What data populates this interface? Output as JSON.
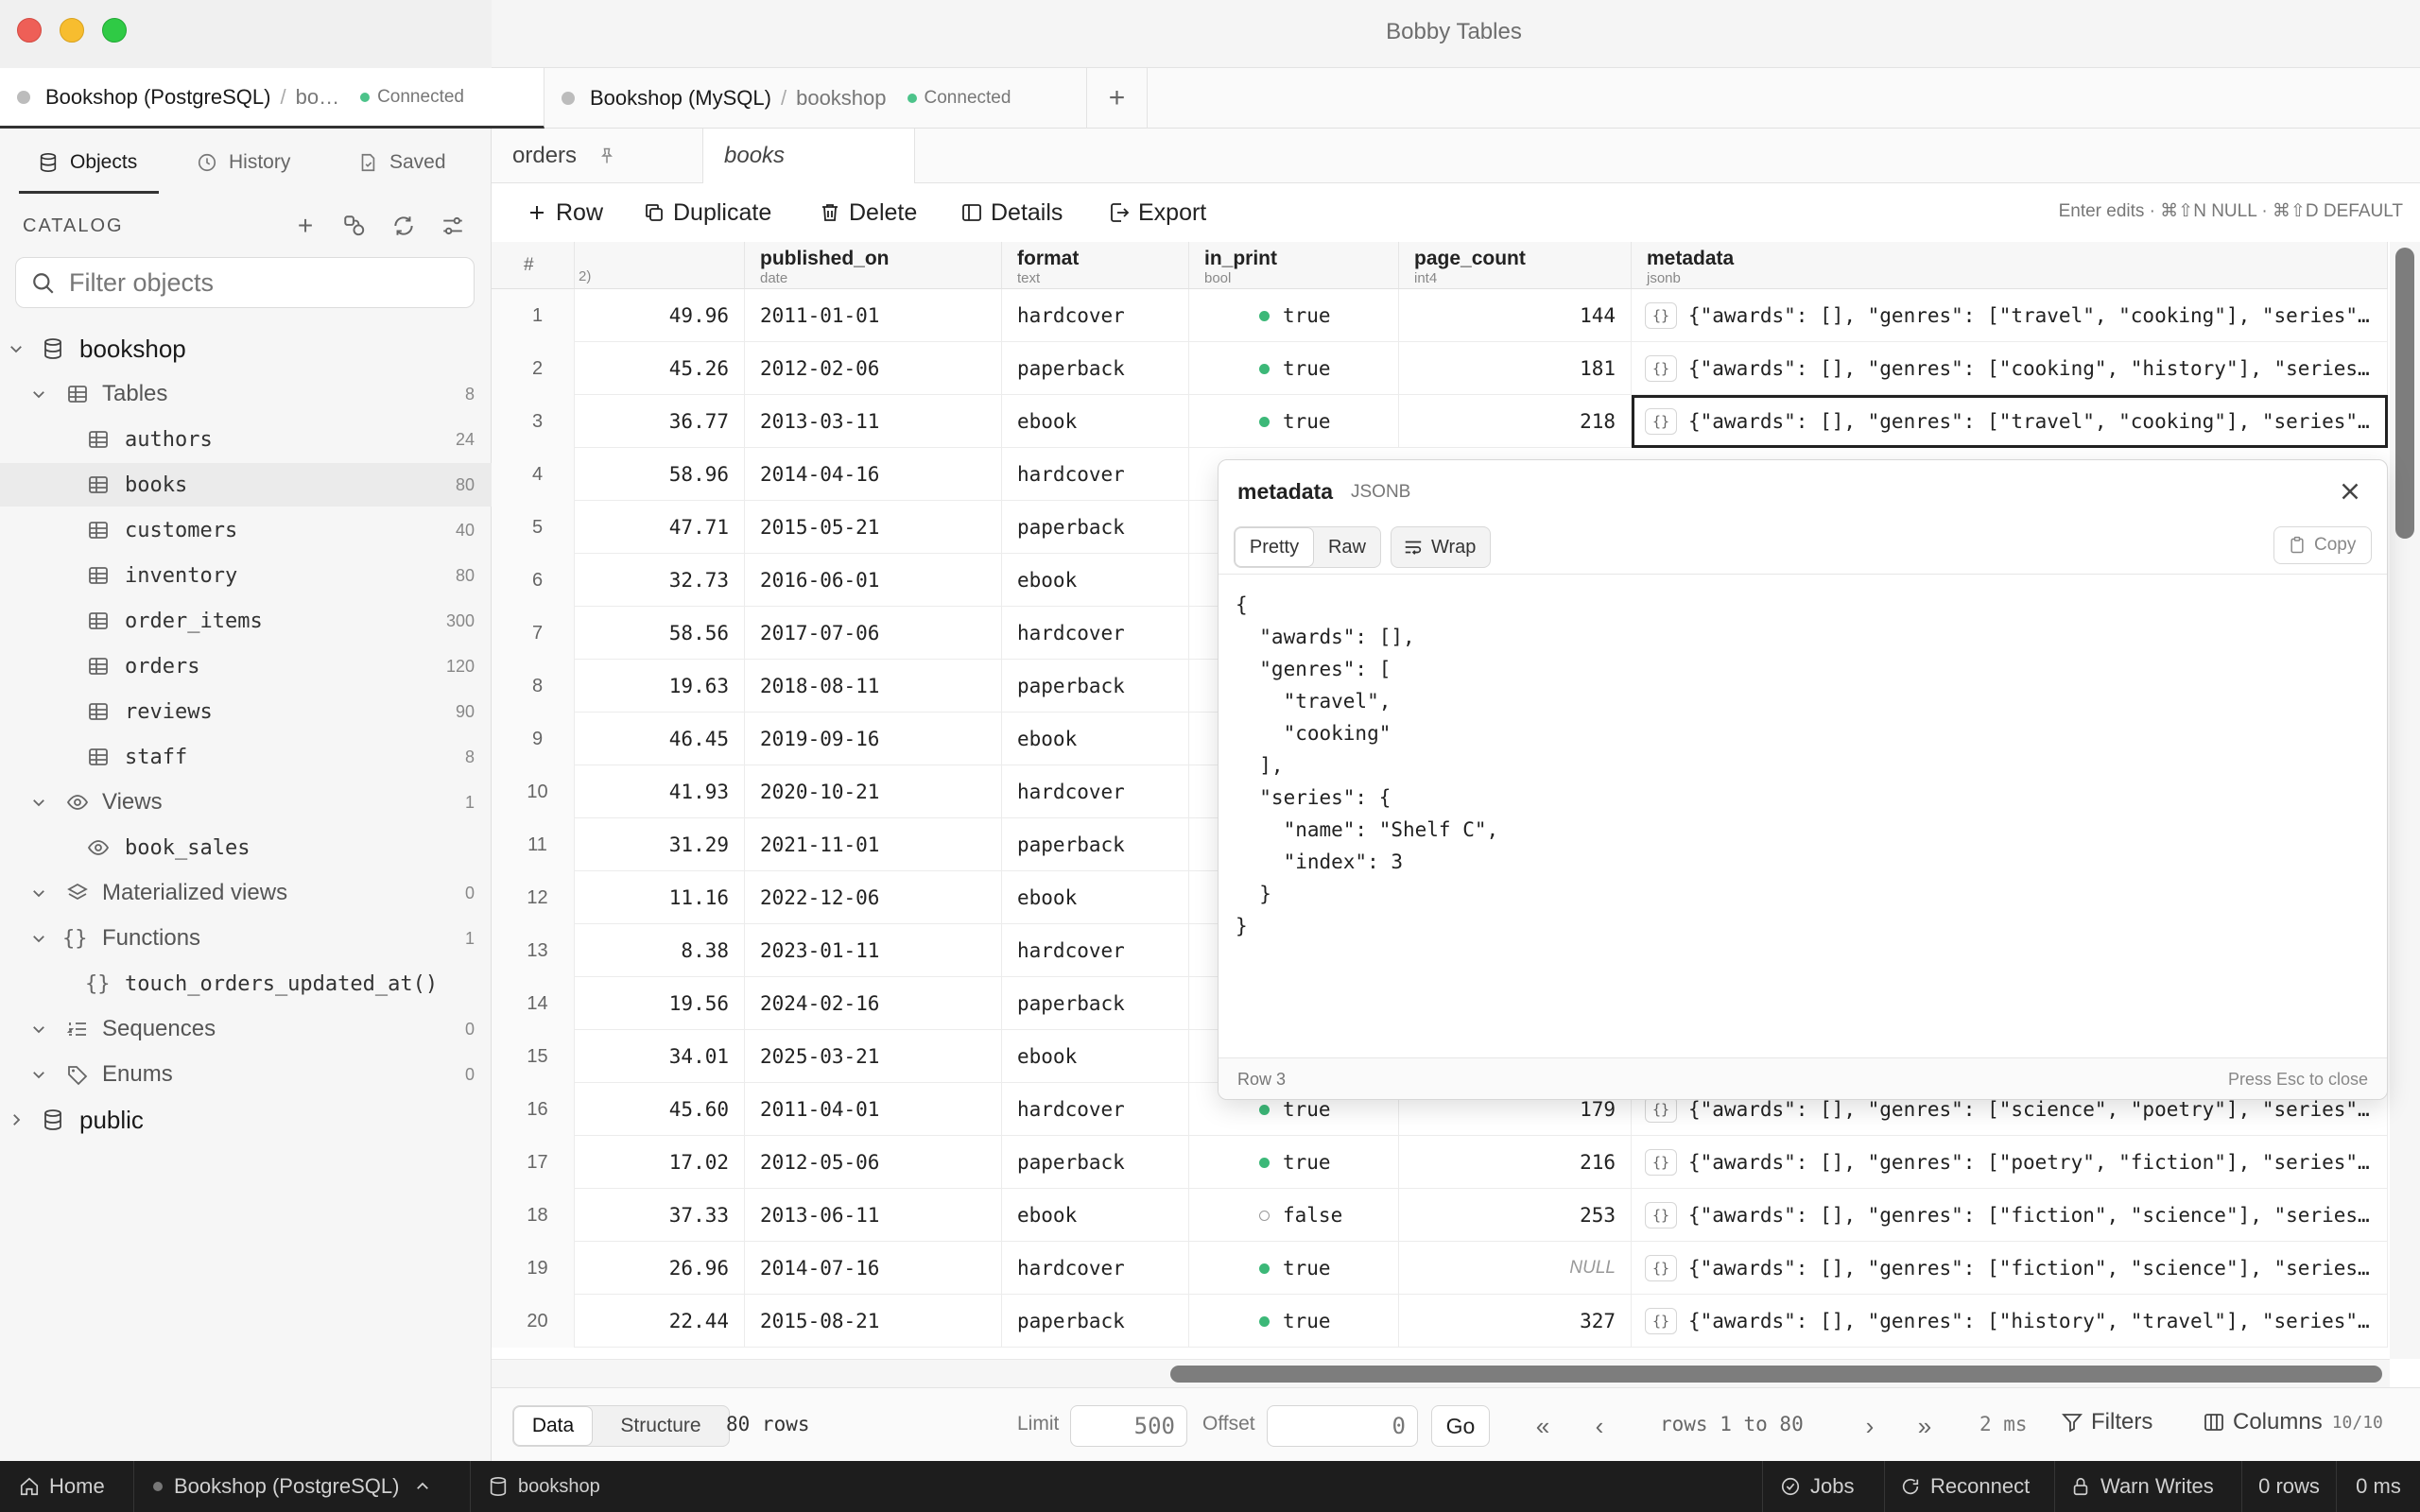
{
  "window": {
    "title": "Bobby Tables"
  },
  "connection_tabs": [
    {
      "name": "Bookshop (PostgreSQL)",
      "database": "bo…",
      "status": "Connected"
    },
    {
      "name": "Bookshop (MySQL)",
      "database": "bookshop",
      "status": "Connected"
    }
  ],
  "sidebar": {
    "tabs": [
      "Objects",
      "History",
      "Saved"
    ],
    "catalog_label": "CATALOG",
    "filter_placeholder": "Filter objects",
    "tree": {
      "database": "bookshop",
      "groups": {
        "tables": {
          "label": "Tables",
          "count": "8"
        },
        "views": {
          "label": "Views",
          "count": "1"
        },
        "materialized": {
          "label": "Materialized views",
          "count": "0"
        },
        "functions": {
          "label": "Functions",
          "count": "1"
        },
        "sequences": {
          "label": "Sequences",
          "count": "0"
        },
        "enums": {
          "label": "Enums",
          "count": "0"
        }
      },
      "tables": [
        {
          "name": "authors",
          "count": "24"
        },
        {
          "name": "books",
          "count": "80"
        },
        {
          "name": "customers",
          "count": "40"
        },
        {
          "name": "inventory",
          "count": "80"
        },
        {
          "name": "order_items",
          "count": "300"
        },
        {
          "name": "orders",
          "count": "120"
        },
        {
          "name": "reviews",
          "count": "90"
        },
        {
          "name": "staff",
          "count": "8"
        }
      ],
      "views": [
        "book_sales"
      ],
      "functions": [
        "touch_orders_updated_at()"
      ],
      "other_schema": "public"
    }
  },
  "doc_tabs": [
    "orders",
    "books"
  ],
  "toolbar": {
    "row": "Row",
    "duplicate": "Duplicate",
    "delete": "Delete",
    "details": "Details",
    "export": "Export",
    "hint": "Enter edits · ⌘⇧N NULL · ⌘⇧D DEFAULT"
  },
  "grid": {
    "rownum_header": "#",
    "partial_header": "2)",
    "columns": [
      {
        "name": "published_on",
        "type": "date"
      },
      {
        "name": "format",
        "type": "text"
      },
      {
        "name": "in_print",
        "type": "bool"
      },
      {
        "name": "page_count",
        "type": "int4"
      },
      {
        "name": "metadata",
        "type": "jsonb"
      }
    ],
    "rows": [
      {
        "n": "1",
        "price": "49.96",
        "published_on": "2011-01-01",
        "format": "hardcover",
        "in_print": "true",
        "page_count": "144",
        "metadata": "{\"awards\": [], \"genres\": [\"travel\", \"cooking\"], \"series\"…"
      },
      {
        "n": "2",
        "price": "45.26",
        "published_on": "2012-02-06",
        "format": "paperback",
        "in_print": "true",
        "page_count": "181",
        "metadata": "{\"awards\": [], \"genres\": [\"cooking\", \"history\"], \"series…"
      },
      {
        "n": "3",
        "price": "36.77",
        "published_on": "2013-03-11",
        "format": "ebook",
        "in_print": "true",
        "page_count": "218",
        "metadata": "{\"awards\": [], \"genres\": [\"travel\", \"cooking\"], \"series\"…"
      },
      {
        "n": "4",
        "price": "58.96",
        "published_on": "2014-04-16",
        "format": "hardcover"
      },
      {
        "n": "5",
        "price": "47.71",
        "published_on": "2015-05-21",
        "format": "paperback"
      },
      {
        "n": "6",
        "price": "32.73",
        "published_on": "2016-06-01",
        "format": "ebook"
      },
      {
        "n": "7",
        "price": "58.56",
        "published_on": "2017-07-06",
        "format": "hardcover"
      },
      {
        "n": "8",
        "price": "19.63",
        "published_on": "2018-08-11",
        "format": "paperback"
      },
      {
        "n": "9",
        "price": "46.45",
        "published_on": "2019-09-16",
        "format": "ebook"
      },
      {
        "n": "10",
        "price": "41.93",
        "published_on": "2020-10-21",
        "format": "hardcover"
      },
      {
        "n": "11",
        "price": "31.29",
        "published_on": "2021-11-01",
        "format": "paperback"
      },
      {
        "n": "12",
        "price": "11.16",
        "published_on": "2022-12-06",
        "format": "ebook"
      },
      {
        "n": "13",
        "price": "8.38",
        "published_on": "2023-01-11",
        "format": "hardcover"
      },
      {
        "n": "14",
        "price": "19.56",
        "published_on": "2024-02-16",
        "format": "paperback"
      },
      {
        "n": "15",
        "price": "34.01",
        "published_on": "2025-03-21",
        "format": "ebook"
      },
      {
        "n": "16",
        "price": "45.60",
        "published_on": "2011-04-01",
        "format": "hardcover",
        "in_print": "true",
        "page_count": "179",
        "metadata": "{\"awards\": [], \"genres\": [\"science\", \"poetry\"], \"series\"…"
      },
      {
        "n": "17",
        "price": "17.02",
        "published_on": "2012-05-06",
        "format": "paperback",
        "in_print": "true",
        "page_count": "216",
        "metadata": "{\"awards\": [], \"genres\": [\"poetry\", \"fiction\"], \"series\"…"
      },
      {
        "n": "18",
        "price": "37.33",
        "published_on": "2013-06-11",
        "format": "ebook",
        "in_print": "false",
        "page_count": "253",
        "metadata": "{\"awards\": [], \"genres\": [\"fiction\", \"science\"], \"series…"
      },
      {
        "n": "19",
        "price": "26.96",
        "published_on": "2014-07-16",
        "format": "hardcover",
        "in_print": "true",
        "page_count": "NULL",
        "metadata": "{\"awards\": [], \"genres\": [\"fiction\", \"science\"], \"series…"
      },
      {
        "n": "20",
        "price": "22.44",
        "published_on": "2015-08-21",
        "format": "paperback",
        "in_print": "true",
        "page_count": "327",
        "metadata": "{\"awards\": [], \"genres\": [\"history\", \"travel\"], \"series\"…"
      }
    ]
  },
  "popover": {
    "title": "metadata",
    "type": "JSONB",
    "modes": [
      "Pretty",
      "Raw"
    ],
    "wrap": "Wrap",
    "copy": "Copy",
    "content": "{\n  \"awards\": [],\n  \"genres\": [\n    \"travel\",\n    \"cooking\"\n  ],\n  \"series\": {\n    \"name\": \"Shelf C\",\n    \"index\": 3\n  }\n}",
    "row_label": "Row 3",
    "esc_hint": "Press Esc to close"
  },
  "bottom_bar": {
    "views": [
      "Data",
      "Structure"
    ],
    "row_count": "80 rows",
    "limit_label": "Limit",
    "limit_value": "500",
    "offset_label": "Offset",
    "offset_value": "0",
    "go": "Go",
    "range": "rows 1 to 80",
    "timing": "2 ms",
    "filters": "Filters",
    "columns": "Columns",
    "columns_count": "10/10"
  },
  "status_bar": {
    "home": "Home",
    "connection": "Bookshop (PostgreSQL)",
    "database": "bookshop",
    "jobs": "Jobs",
    "reconnect": "Reconnect",
    "warn_writes": "Warn Writes",
    "rows": "0 rows",
    "ms": "0 ms"
  },
  "colors": {
    "connected": "#4cc38a",
    "bool_true": "#3cb878",
    "statusbar_bg": "#1d1d1d"
  }
}
